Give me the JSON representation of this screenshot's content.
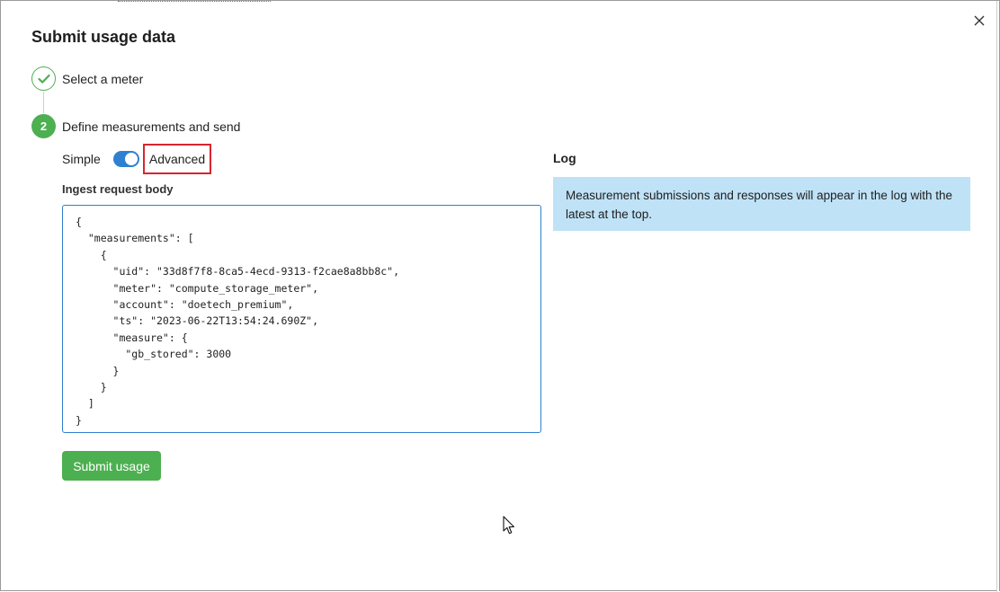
{
  "dialog": {
    "title": "Submit usage data",
    "close_icon": "close-icon"
  },
  "steps": [
    {
      "label": "Select a meter",
      "state": "completed",
      "icon": "check-icon"
    },
    {
      "label": "Define measurements and send",
      "state": "active",
      "number": "2"
    }
  ],
  "mode": {
    "simple_label": "Simple",
    "advanced_label": "Advanced",
    "toggle_on": true
  },
  "ingest": {
    "label": "Ingest request body",
    "body": "{\n  \"measurements\": [\n    {\n      \"uid\": \"33d8f7f8-8ca5-4ecd-9313-f2cae8a8bb8c\",\n      \"meter\": \"compute_storage_meter\",\n      \"account\": \"doetech_premium\",\n      \"ts\": \"2023-06-22T13:54:24.690Z\",\n      \"measure\": {\n        \"gb_stored\": 3000\n      }\n    }\n  ]\n}"
  },
  "submit_label": "Submit usage",
  "log": {
    "title": "Log",
    "message": "Measurement submissions and responses will appear in the log with the latest at the top."
  },
  "colors": {
    "accent_green": "#4caf50",
    "toggle_blue": "#2f80d1",
    "highlight_red": "#d6262f",
    "log_bg": "#bfe2f7"
  }
}
